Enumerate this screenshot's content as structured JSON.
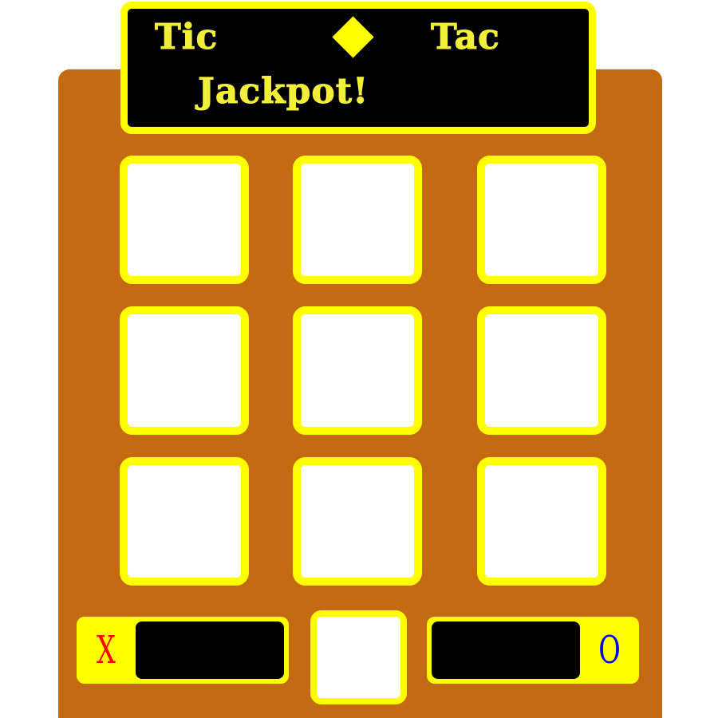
{
  "title": {
    "word1": "Tic",
    "word2": "Tac",
    "word3": "Jackpot!"
  },
  "board": {
    "cells": [
      "",
      "",
      "",
      "",
      "",
      "",
      "",
      "",
      ""
    ]
  },
  "players": {
    "x": {
      "symbol": "X",
      "score": ""
    },
    "o": {
      "symbol": "O",
      "score": ""
    }
  },
  "colors": {
    "cabinet": "#c46a12",
    "accent": "#ffff00",
    "panel": "#000000",
    "x_color": "#ff0000",
    "o_color": "#0000ff"
  }
}
